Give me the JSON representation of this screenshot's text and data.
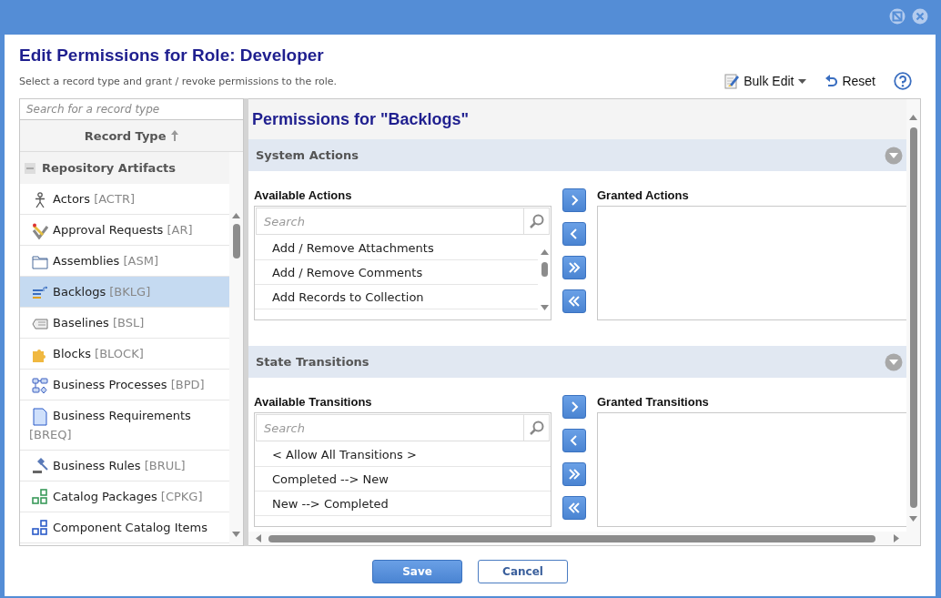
{
  "window": {
    "title": "Edit Permissions for Role: Developer",
    "subtitle": "Select a record type and grant / revoke permissions to the role."
  },
  "toolbar": {
    "bulk_edit": "Bulk Edit",
    "reset": "Reset"
  },
  "record_types": {
    "search_placeholder": "Search for a record type",
    "column": "Record Type",
    "groups": [
      {
        "label": "Repository Artifacts",
        "expanded": true,
        "items": [
          {
            "name": "Actors",
            "code": "[ACTR]",
            "selected": false
          },
          {
            "name": "Approval Requests",
            "code": "[AR]",
            "selected": false
          },
          {
            "name": "Assemblies",
            "code": "[ASM]",
            "selected": false
          },
          {
            "name": "Backlogs",
            "code": "[BKLG]",
            "selected": true
          },
          {
            "name": "Baselines",
            "code": "[BSL]",
            "selected": false
          },
          {
            "name": "Blocks",
            "code": "[BLOCK]",
            "selected": false
          },
          {
            "name": "Business Processes",
            "code": "[BPD]",
            "selected": false
          },
          {
            "name": "Business Requirements",
            "code": "[BREQ]",
            "selected": false
          },
          {
            "name": "Business Rules",
            "code": "[BRUL]",
            "selected": false
          },
          {
            "name": "Catalog Packages",
            "code": "[CPKG]",
            "selected": false
          },
          {
            "name": "Component Catalog Items",
            "selected": false
          }
        ]
      }
    ]
  },
  "permissions": {
    "title": "Permissions for \"Backlogs\"",
    "sections": [
      {
        "title": "System Actions",
        "available_label": "Available Actions",
        "search_placeholder": "Search",
        "available": [
          "Add / Remove Attachments",
          "Add / Remove Comments",
          "Add Records to Collection"
        ],
        "scrollable": true,
        "granted_label": "Granted Actions"
      },
      {
        "title": "State Transitions",
        "available_label": "Available Transitions",
        "search_placeholder": "Search",
        "available": [
          "< Allow All Transitions >",
          "Completed --> New",
          "New --> Completed"
        ],
        "scrollable": false,
        "granted_label": "Granted Transitions"
      }
    ]
  },
  "buttons": [
    {
      "label": "Save",
      "kind": "primary"
    },
    {
      "label": "Cancel",
      "kind": "secondary"
    }
  ]
}
